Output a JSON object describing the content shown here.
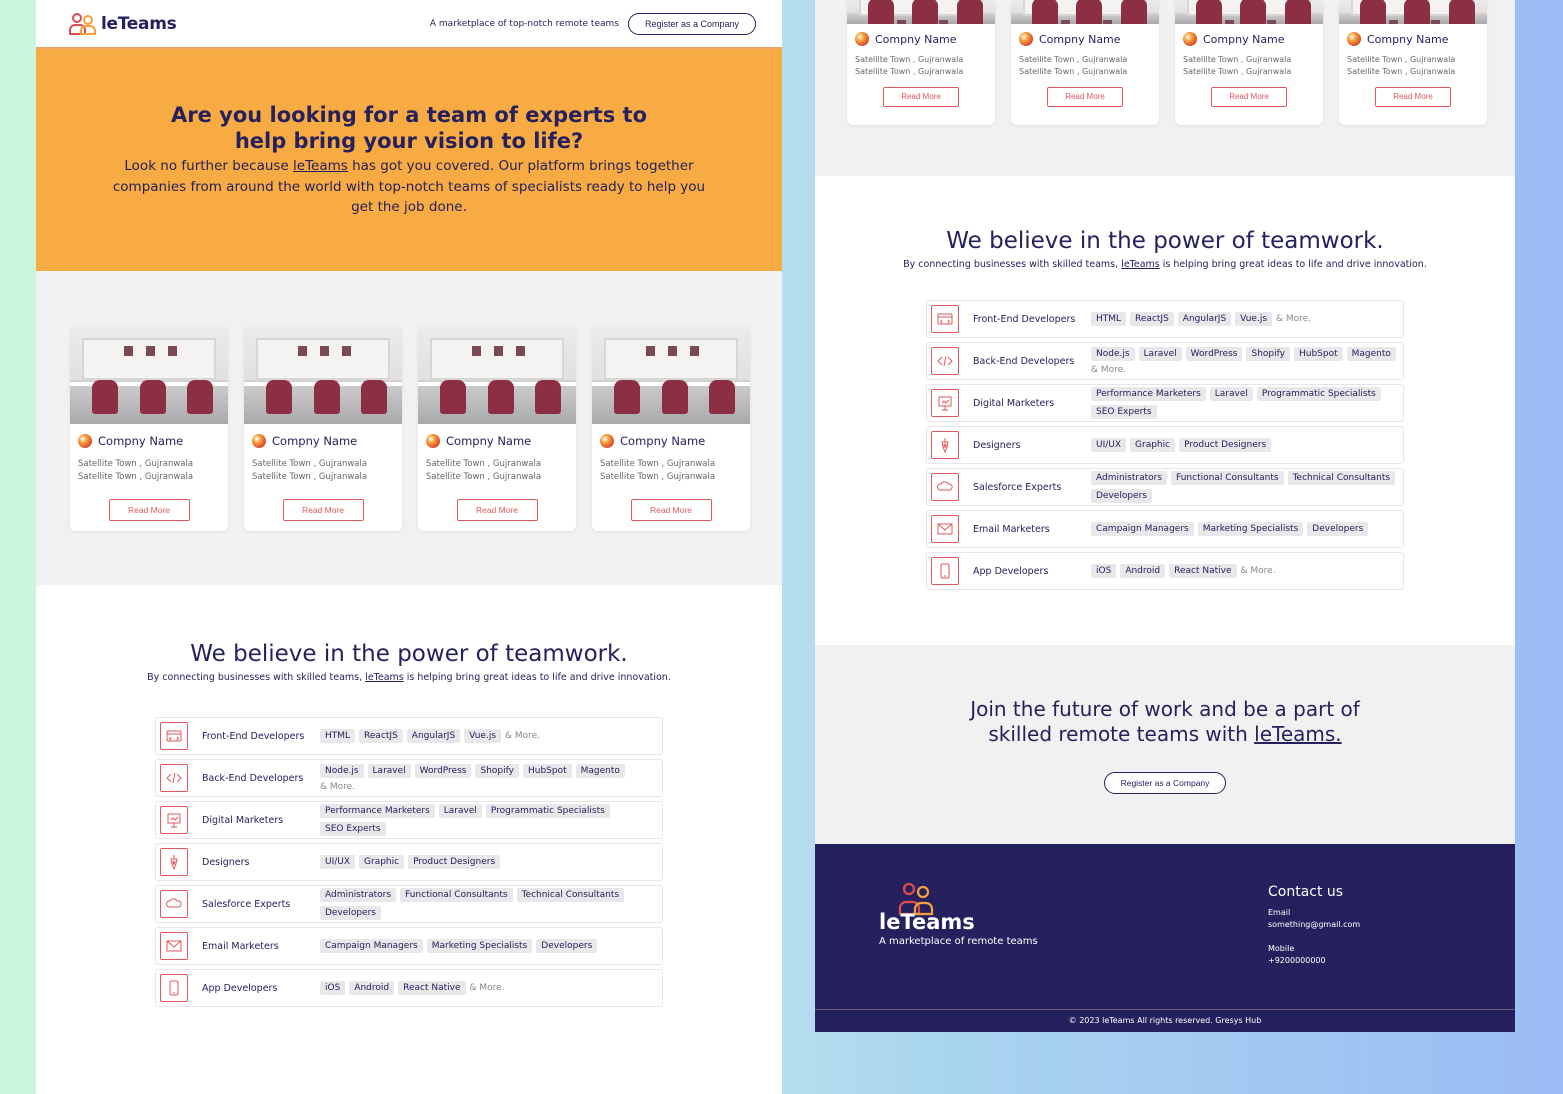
{
  "header": {
    "brand": "leTeams",
    "tagline": "A marketplace of top-notch remote teams",
    "register_label": "Register as a Company"
  },
  "hero": {
    "title": "Are you looking for a team of experts to help bring your vision to life?",
    "text_before": "Look no further because ",
    "link": "leTeams",
    "text_after": " has got you covered. Our platform brings together companies from around the world with top-notch teams of specialists ready to help you get the job done."
  },
  "cards": [
    {
      "name": "Compny Name",
      "loc1": "Satellite Town , Gujranwala",
      "loc2": "Satellite Town , Gujranwala",
      "button": "Read More"
    },
    {
      "name": "Compny Name",
      "loc1": "Satellite Town , Gujranwala",
      "loc2": "Satellite Town , Gujranwala",
      "button": "Read More"
    },
    {
      "name": "Compny Name",
      "loc1": "Satellite Town , Gujranwala",
      "loc2": "Satellite Town , Gujranwala",
      "button": "Read More"
    },
    {
      "name": "Compny Name",
      "loc1": "Satellite Town , Gujranwala",
      "loc2": "Satellite Town , Gujranwala",
      "button": "Read More"
    }
  ],
  "teamwork": {
    "title": "We believe in the power of teamwork.",
    "sub_before": "By connecting businesses with skilled teams, ",
    "sub_link": "leTeams",
    "sub_after": " is helping bring great ideas to life and drive innovation.",
    "rows": [
      {
        "icon": "code-window-icon",
        "label": "Front-End Developers",
        "tags": [
          "HTML",
          "ReactJS",
          "AngularJS",
          "Vue.js"
        ],
        "more": "& More."
      },
      {
        "icon": "code-brackets-icon",
        "label": "Back-End Developers",
        "tags": [
          "Node.js",
          "Laravel",
          "WordPress",
          "Shopify",
          "HubSpot",
          "Magento"
        ],
        "more": "& More."
      },
      {
        "icon": "presentation-icon",
        "label": "Digital Marketers",
        "tags": [
          "Performance Marketers",
          "Laravel",
          "Programmatic Specialists",
          "SEO Experts"
        ],
        "more": ""
      },
      {
        "icon": "pen-tool-icon",
        "label": "Designers",
        "tags": [
          "UI/UX",
          "Graphic",
          "Product Designers"
        ],
        "more": ""
      },
      {
        "icon": "salesforce-cloud-icon",
        "label": "Salesforce Experts",
        "tags": [
          "Administrators",
          "Functional Consultants",
          "Technical Consultants",
          "Developers"
        ],
        "more": ""
      },
      {
        "icon": "envelope-icon",
        "label": "Email Marketers",
        "tags": [
          "Campaign Managers",
          "Marketing Specialists",
          "Developers"
        ],
        "more": ""
      },
      {
        "icon": "mobile-phone-icon",
        "label": "App Developers",
        "tags": [
          "iOS",
          "Android",
          "React Native"
        ],
        "more": "& More."
      }
    ]
  },
  "join": {
    "line1": "Join the future of work and be a part of",
    "line2_before": "skilled remote teams with ",
    "line2_link": "leTeams.",
    "button": "Register as a Company"
  },
  "footer": {
    "brand": "leTeams",
    "tagline": "A marketplace of remote teams",
    "contact_title": "Contact us",
    "email_label": "Email",
    "email": "something@gmail.com",
    "mobile_label": "Mobile",
    "mobile": "+9200000000",
    "copyright": "© 2023 leTeams All rights reserved. Gresys Hub"
  },
  "colors": {
    "navy": "#25215e",
    "orange": "#f8ab42",
    "accent_red": "#e0585b"
  }
}
